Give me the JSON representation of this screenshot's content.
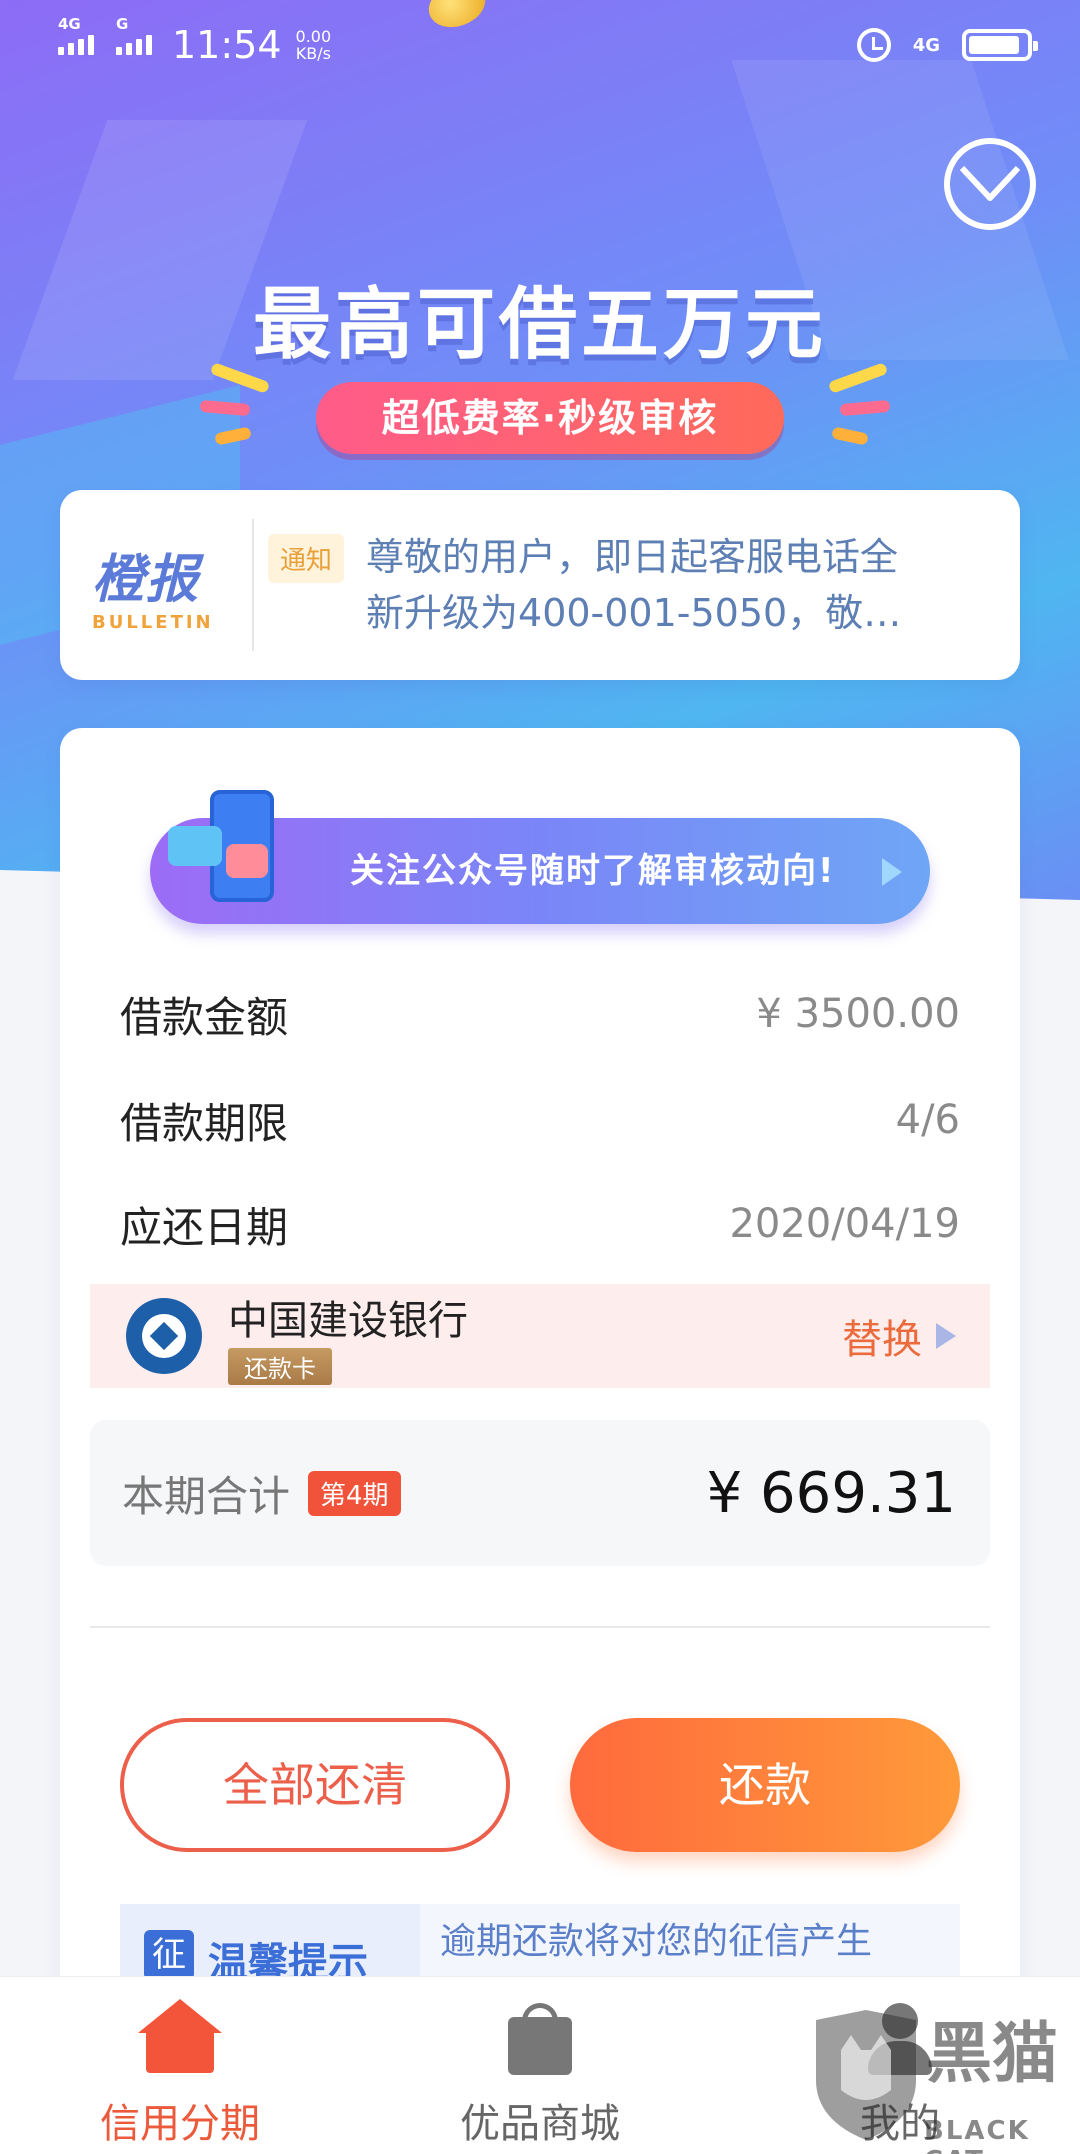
{
  "status_bar": {
    "signal1_tag": "4G",
    "signal2_tag": "G",
    "time": "11:54",
    "net_speed_value": "0.00",
    "net_speed_unit": "KB/s",
    "network": "4G",
    "battery_level": 0.9
  },
  "banner": {
    "title": "最高可借五万元",
    "subtitle": "超低费率·秒级审核"
  },
  "bulletin": {
    "logo_cn": "橙报",
    "logo_en": "BULLETIN",
    "tag": "通知",
    "line1": "尊敬的用户，即日起客服电话全",
    "line2": "新升级为400-001-5050，敬…"
  },
  "promo": {
    "text": "关注公众号随时了解审核动向!"
  },
  "loan": {
    "amount_label": "借款金额",
    "amount_value": "¥ 3500.00",
    "term_label": "借款期限",
    "term_value": "4/6",
    "due_label": "应还日期",
    "due_value": "2020/04/19"
  },
  "bank": {
    "name": "中国建设银行",
    "card_tag": "还款卡",
    "switch_label": "替换"
  },
  "summary": {
    "label": "本期合计",
    "period_badge": "第4期",
    "amount": "¥ 669.31"
  },
  "actions": {
    "pay_all": "全部还清",
    "pay": "还款"
  },
  "tips": {
    "icon_char": "征",
    "title": "温馨提示",
    "text": "逾期还款将对您的征信产生"
  },
  "tabbar": {
    "tab1": "信用分期",
    "tab2": "优品商城",
    "tab3": "我的"
  },
  "watermark": {
    "cn": "黑猫",
    "en": "BLACK CAT"
  },
  "colors": {
    "accent": "#ec5a3c",
    "hero_start": "#8d6cf6",
    "hero_end": "#4fb6f1",
    "bulletin_text": "#5d7fb4"
  }
}
